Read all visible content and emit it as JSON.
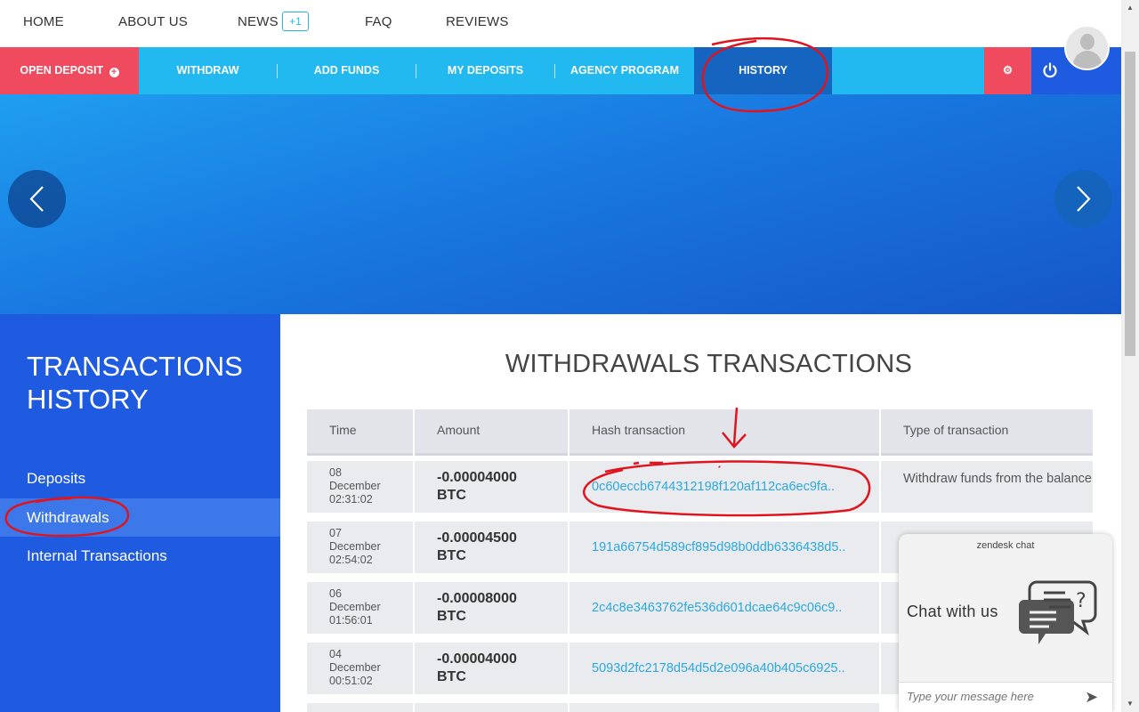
{
  "topnav": {
    "home": "HOME",
    "about": "ABOUT US",
    "news": "NEWS",
    "news_badge": "+1",
    "faq": "FAQ",
    "reviews": "REVIEWS"
  },
  "actionbar": {
    "open_deposit": "OPEN DEPOSIT",
    "withdraw": "WITHDRAW",
    "add_funds": "ADD FUNDS",
    "my_deposits": "MY DEPOSITS",
    "agency_program": "AGENCY PROGRAM",
    "history": "HISTORY",
    "settings_icon": "gear-icon",
    "logout_icon": "power-icon"
  },
  "sidebar": {
    "title": "TRANSACTIONS HISTORY",
    "items": [
      {
        "label": "Deposits",
        "active": false
      },
      {
        "label": "Withdrawals",
        "active": true
      },
      {
        "label": "Internal Transactions",
        "active": false
      }
    ]
  },
  "main": {
    "heading": "WITHDRAWALS TRANSACTIONS",
    "columns": [
      "Time",
      "Amount",
      "Hash transaction",
      "Type of transaction"
    ],
    "rows": [
      {
        "day": "08",
        "month": "December",
        "time": "02:31:02",
        "amount": "-0.00004000",
        "currency": "BTC",
        "hash": "0c60eccb6744312198f120af112ca6ec9fa..",
        "type": "Withdraw funds from the balance"
      },
      {
        "day": "07",
        "month": "December",
        "time": "02:54:02",
        "amount": "-0.00004500",
        "currency": "BTC",
        "hash": "191a66754d589cf895d98b0ddb6336438d5..",
        "type": ""
      },
      {
        "day": "06",
        "month": "December",
        "time": "01:56:01",
        "amount": "-0.00008000",
        "currency": "BTC",
        "hash": "2c4c8e3463762fe536d601dcae64c9c06c9..",
        "type": ""
      },
      {
        "day": "04",
        "month": "December",
        "time": "00:51:02",
        "amount": "-0.00004000",
        "currency": "BTC",
        "hash": "5093d2fc2178d54d5d2e096a40b405c6925..",
        "type": ""
      }
    ]
  },
  "chat": {
    "brand": "zendesk chat",
    "prompt": "Chat with us",
    "placeholder": "Type your message here"
  },
  "colors": {
    "accent_blue": "#22b8f0",
    "primary_blue": "#1e5be0",
    "deposit_red": "#f04a5e",
    "link_blue": "#29a9e3",
    "annotation_red": "#e0141e"
  }
}
